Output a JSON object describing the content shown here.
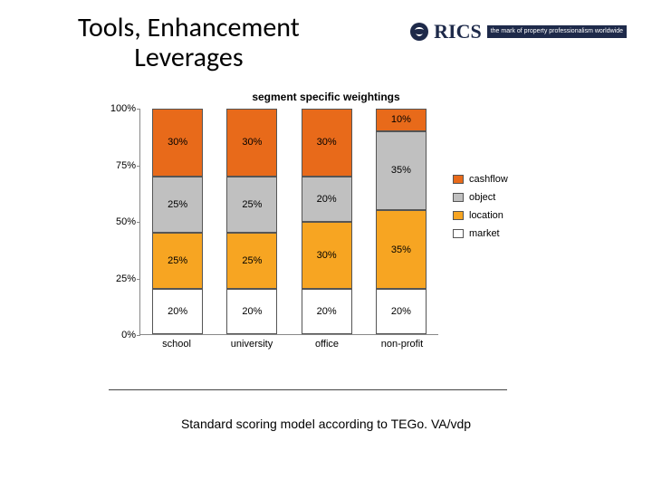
{
  "title_line1": "Tools, Enhancement",
  "title_line2": "Leverages",
  "logo": {
    "text": "RICS",
    "tagline": "the mark of property professionalism worldwide"
  },
  "caption": "Standard scoring model according to TEGo. VA/vdp",
  "chart_data": {
    "type": "bar",
    "stacked": true,
    "title": "segment specific weightings",
    "xlabel": "",
    "ylabel": "",
    "ylim": [
      0,
      100
    ],
    "y_ticks": [
      "0%",
      "25%",
      "50%",
      "75%",
      "100%"
    ],
    "categories": [
      "school",
      "university",
      "office",
      "non-profit"
    ],
    "series": [
      {
        "name": "market",
        "values": [
          20,
          20,
          20,
          20
        ],
        "color": "#ffffff"
      },
      {
        "name": "location",
        "values": [
          25,
          25,
          30,
          35
        ],
        "color": "#f7a522"
      },
      {
        "name": "object",
        "values": [
          25,
          25,
          20,
          35
        ],
        "color": "#c0c0c0"
      },
      {
        "name": "cashflow",
        "values": [
          30,
          30,
          30,
          10
        ],
        "color": "#e86a1a"
      }
    ],
    "legend": [
      "cashflow",
      "object",
      "location",
      "market"
    ]
  }
}
